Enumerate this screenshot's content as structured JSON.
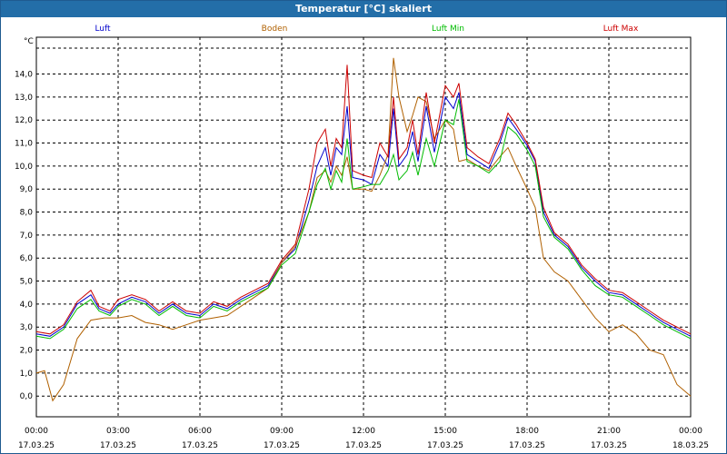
{
  "window": {
    "title": "Temperatur [°C] skaliert"
  },
  "chart_data": {
    "type": "line",
    "unit_label": "°C",
    "y_ticks": [
      "14,0",
      "13,0",
      "12,0",
      "11,0",
      "10,0",
      "9,0",
      "8,0",
      "7,0",
      "6,0",
      "5,0",
      "4,0",
      "3,0",
      "2,0",
      "1,0",
      "0,0"
    ],
    "ylim": [
      -0.9,
      15.6
    ],
    "xlim": [
      0,
      24
    ],
    "x_ticks": [
      {
        "time": "00:00",
        "date": "17.03.25"
      },
      {
        "time": "03:00",
        "date": "17.03.25"
      },
      {
        "time": "06:00",
        "date": "17.03.25"
      },
      {
        "time": "09:00",
        "date": "17.03.25"
      },
      {
        "time": "12:00",
        "date": "17.03.25"
      },
      {
        "time": "15:00",
        "date": "17.03.25"
      },
      {
        "time": "18:00",
        "date": "17.03.25"
      },
      {
        "time": "21:00",
        "date": "17.03.25"
      },
      {
        "time": "00:00",
        "date": "18.03.25"
      }
    ],
    "grid": true,
    "legend_position": "top",
    "series": [
      {
        "name": "Luft",
        "color": "#0000cc",
        "points": [
          [
            0,
            2.7
          ],
          [
            0.5,
            2.6
          ],
          [
            1,
            3.0
          ],
          [
            1.5,
            4.0
          ],
          [
            2,
            4.4
          ],
          [
            2.3,
            3.8
          ],
          [
            2.7,
            3.6
          ],
          [
            3,
            4.0
          ],
          [
            3.5,
            4.3
          ],
          [
            4,
            4.1
          ],
          [
            4.5,
            3.6
          ],
          [
            5,
            4.0
          ],
          [
            5.5,
            3.6
          ],
          [
            6,
            3.5
          ],
          [
            6.5,
            4.0
          ],
          [
            7,
            3.8
          ],
          [
            7.5,
            4.2
          ],
          [
            8,
            4.5
          ],
          [
            8.5,
            4.8
          ],
          [
            9,
            5.8
          ],
          [
            9.5,
            6.4
          ],
          [
            10,
            8.5
          ],
          [
            10.3,
            10.0
          ],
          [
            10.6,
            10.8
          ],
          [
            10.8,
            9.6
          ],
          [
            11,
            10.8
          ],
          [
            11.2,
            10.5
          ],
          [
            11.4,
            12.6
          ],
          [
            11.6,
            9.5
          ],
          [
            12,
            9.4
          ],
          [
            12.3,
            9.2
          ],
          [
            12.6,
            10.5
          ],
          [
            12.9,
            10.0
          ],
          [
            13.1,
            12.5
          ],
          [
            13.3,
            10.0
          ],
          [
            13.6,
            10.5
          ],
          [
            13.8,
            11.5
          ],
          [
            14,
            10.2
          ],
          [
            14.3,
            12.6
          ],
          [
            14.6,
            10.6
          ],
          [
            15,
            13.0
          ],
          [
            15.3,
            12.5
          ],
          [
            15.5,
            13.2
          ],
          [
            15.8,
            10.5
          ],
          [
            16.2,
            10.2
          ],
          [
            16.6,
            9.9
          ],
          [
            17,
            11.0
          ],
          [
            17.3,
            12.1
          ],
          [
            17.6,
            11.6
          ],
          [
            18,
            10.9
          ],
          [
            18.3,
            10.2
          ],
          [
            18.6,
            8.0
          ],
          [
            19,
            7.0
          ],
          [
            19.5,
            6.5
          ],
          [
            20,
            5.6
          ],
          [
            20.5,
            5.0
          ],
          [
            21,
            4.5
          ],
          [
            21.5,
            4.4
          ],
          [
            22,
            4.0
          ],
          [
            22.5,
            3.6
          ],
          [
            23,
            3.2
          ],
          [
            23.5,
            2.9
          ],
          [
            24,
            2.6
          ]
        ]
      },
      {
        "name": "Boden",
        "color": "#b06000",
        "points": [
          [
            0,
            1.0
          ],
          [
            0.3,
            1.1
          ],
          [
            0.6,
            -0.2
          ],
          [
            1,
            0.5
          ],
          [
            1.5,
            2.5
          ],
          [
            2,
            3.3
          ],
          [
            2.5,
            3.4
          ],
          [
            3,
            3.4
          ],
          [
            3.5,
            3.5
          ],
          [
            4,
            3.2
          ],
          [
            4.5,
            3.1
          ],
          [
            5,
            2.9
          ],
          [
            5.5,
            3.1
          ],
          [
            6,
            3.3
          ],
          [
            6.5,
            3.4
          ],
          [
            7,
            3.5
          ],
          [
            7.5,
            3.9
          ],
          [
            8,
            4.3
          ],
          [
            8.5,
            4.7
          ],
          [
            9,
            5.8
          ],
          [
            9.5,
            6.5
          ],
          [
            10,
            8.0
          ],
          [
            10.3,
            9.5
          ],
          [
            10.6,
            9.8
          ],
          [
            10.8,
            9.3
          ],
          [
            11,
            10.0
          ],
          [
            11.2,
            9.6
          ],
          [
            11.4,
            10.4
          ],
          [
            11.6,
            9.0
          ],
          [
            12,
            9.0
          ],
          [
            12.3,
            8.9
          ],
          [
            12.6,
            9.6
          ],
          [
            12.9,
            10.5
          ],
          [
            13.1,
            14.7
          ],
          [
            13.3,
            13.0
          ],
          [
            13.6,
            11.5
          ],
          [
            13.8,
            12.2
          ],
          [
            14,
            13.0
          ],
          [
            14.3,
            12.8
          ],
          [
            14.6,
            11.2
          ],
          [
            15,
            12.0
          ],
          [
            15.3,
            11.6
          ],
          [
            15.5,
            10.2
          ],
          [
            15.8,
            10.3
          ],
          [
            16.2,
            10.0
          ],
          [
            16.6,
            9.8
          ],
          [
            17,
            10.4
          ],
          [
            17.3,
            10.8
          ],
          [
            17.6,
            10.0
          ],
          [
            18,
            9.0
          ],
          [
            18.3,
            8.2
          ],
          [
            18.6,
            6.0
          ],
          [
            19,
            5.4
          ],
          [
            19.5,
            5.0
          ],
          [
            20,
            4.2
          ],
          [
            20.5,
            3.4
          ],
          [
            21,
            2.8
          ],
          [
            21.5,
            3.1
          ],
          [
            22,
            2.7
          ],
          [
            22.5,
            2.0
          ],
          [
            23,
            1.8
          ],
          [
            23.5,
            0.5
          ],
          [
            24,
            0.0
          ]
        ]
      },
      {
        "name": "Luft Min",
        "color": "#00bb00",
        "points": [
          [
            0,
            2.6
          ],
          [
            0.5,
            2.5
          ],
          [
            1,
            2.9
          ],
          [
            1.5,
            3.8
          ],
          [
            2,
            4.2
          ],
          [
            2.3,
            3.7
          ],
          [
            2.7,
            3.5
          ],
          [
            3,
            3.9
          ],
          [
            3.5,
            4.2
          ],
          [
            4,
            4.0
          ],
          [
            4.5,
            3.5
          ],
          [
            5,
            3.9
          ],
          [
            5.5,
            3.5
          ],
          [
            6,
            3.4
          ],
          [
            6.5,
            3.9
          ],
          [
            7,
            3.7
          ],
          [
            7.5,
            4.1
          ],
          [
            8,
            4.4
          ],
          [
            8.5,
            4.7
          ],
          [
            9,
            5.7
          ],
          [
            9.5,
            6.2
          ],
          [
            10,
            8.0
          ],
          [
            10.3,
            9.2
          ],
          [
            10.6,
            9.9
          ],
          [
            10.8,
            9.0
          ],
          [
            11,
            9.8
          ],
          [
            11.2,
            9.3
          ],
          [
            11.4,
            11.2
          ],
          [
            11.6,
            9.0
          ],
          [
            12,
            9.1
          ],
          [
            12.3,
            9.2
          ],
          [
            12.6,
            9.2
          ],
          [
            12.9,
            9.8
          ],
          [
            13.1,
            10.5
          ],
          [
            13.3,
            9.4
          ],
          [
            13.6,
            9.8
          ],
          [
            13.8,
            10.6
          ],
          [
            14,
            9.6
          ],
          [
            14.3,
            11.2
          ],
          [
            14.6,
            10.0
          ],
          [
            15,
            12.0
          ],
          [
            15.3,
            11.8
          ],
          [
            15.5,
            12.9
          ],
          [
            15.8,
            10.2
          ],
          [
            16.2,
            10.0
          ],
          [
            16.6,
            9.7
          ],
          [
            17,
            10.2
          ],
          [
            17.3,
            11.7
          ],
          [
            17.6,
            11.4
          ],
          [
            18,
            10.7
          ],
          [
            18.3,
            10.0
          ],
          [
            18.6,
            7.8
          ],
          [
            19,
            6.9
          ],
          [
            19.5,
            6.4
          ],
          [
            20,
            5.5
          ],
          [
            20.5,
            4.8
          ],
          [
            21,
            4.4
          ],
          [
            21.5,
            4.3
          ],
          [
            22,
            3.9
          ],
          [
            22.5,
            3.5
          ],
          [
            23,
            3.1
          ],
          [
            23.5,
            2.8
          ],
          [
            24,
            2.5
          ]
        ]
      },
      {
        "name": "Luft Max",
        "color": "#cc0000",
        "points": [
          [
            0,
            2.8
          ],
          [
            0.5,
            2.7
          ],
          [
            1,
            3.1
          ],
          [
            1.5,
            4.1
          ],
          [
            2,
            4.6
          ],
          [
            2.3,
            3.9
          ],
          [
            2.7,
            3.7
          ],
          [
            3,
            4.2
          ],
          [
            3.5,
            4.4
          ],
          [
            4,
            4.2
          ],
          [
            4.5,
            3.7
          ],
          [
            5,
            4.1
          ],
          [
            5.5,
            3.7
          ],
          [
            6,
            3.6
          ],
          [
            6.5,
            4.1
          ],
          [
            7,
            3.9
          ],
          [
            7.5,
            4.3
          ],
          [
            8,
            4.6
          ],
          [
            8.5,
            4.9
          ],
          [
            9,
            5.9
          ],
          [
            9.5,
            6.6
          ],
          [
            10,
            9.0
          ],
          [
            10.3,
            11.0
          ],
          [
            10.6,
            11.6
          ],
          [
            10.8,
            10.0
          ],
          [
            11,
            11.2
          ],
          [
            11.2,
            10.8
          ],
          [
            11.4,
            14.4
          ],
          [
            11.6,
            9.8
          ],
          [
            12,
            9.6
          ],
          [
            12.3,
            9.5
          ],
          [
            12.6,
            11.0
          ],
          [
            12.9,
            10.4
          ],
          [
            13.1,
            13.0
          ],
          [
            13.3,
            10.3
          ],
          [
            13.6,
            10.8
          ],
          [
            13.8,
            12.0
          ],
          [
            14,
            10.5
          ],
          [
            14.3,
            13.2
          ],
          [
            14.6,
            11.0
          ],
          [
            15,
            13.5
          ],
          [
            15.3,
            13.0
          ],
          [
            15.5,
            13.6
          ],
          [
            15.8,
            10.8
          ],
          [
            16.2,
            10.4
          ],
          [
            16.6,
            10.1
          ],
          [
            17,
            11.2
          ],
          [
            17.3,
            12.3
          ],
          [
            17.6,
            11.8
          ],
          [
            18,
            11.0
          ],
          [
            18.3,
            10.3
          ],
          [
            18.6,
            8.2
          ],
          [
            19,
            7.1
          ],
          [
            19.5,
            6.6
          ],
          [
            20,
            5.7
          ],
          [
            20.5,
            5.1
          ],
          [
            21,
            4.6
          ],
          [
            21.5,
            4.5
          ],
          [
            22,
            4.1
          ],
          [
            22.5,
            3.7
          ],
          [
            23,
            3.3
          ],
          [
            23.5,
            3.0
          ],
          [
            24,
            2.7
          ]
        ]
      }
    ]
  }
}
